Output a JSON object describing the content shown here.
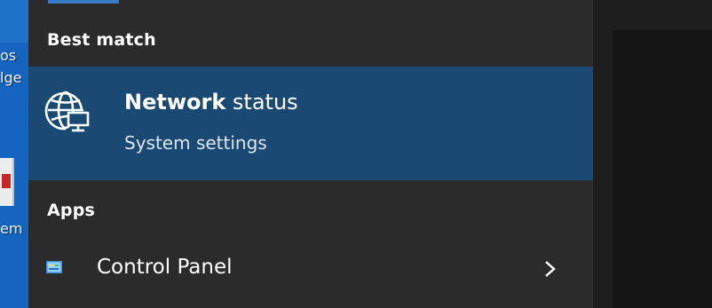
{
  "desktop": {
    "icon_labels": [
      "os",
      "lge",
      "em"
    ]
  },
  "search_results": {
    "best_match_header": "Best match",
    "best_match": {
      "title_bold": "Network",
      "title_rest": " status",
      "subtitle": "System settings",
      "icon": "globe-monitor-icon"
    },
    "apps_header": "Apps",
    "apps": [
      {
        "label": "Control Panel",
        "icon": "control-panel-icon",
        "expand_icon": "chevron-right-icon"
      }
    ]
  },
  "colors": {
    "panel_background": "#2b2b2b",
    "selected_background": "#1a4a73",
    "preview_background": "#151515",
    "desktop_blue": "#1565c0",
    "accent": "#3a79c4"
  }
}
